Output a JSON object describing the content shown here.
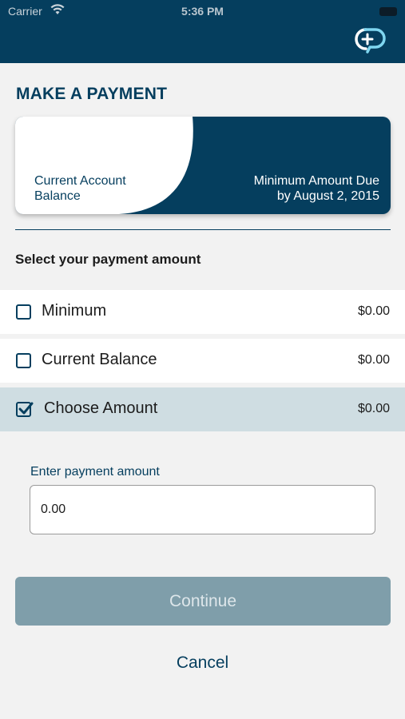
{
  "status_bar": {
    "carrier": "Carrier",
    "time": "5:36 PM"
  },
  "header": {
    "logo_icon": "cp-logo-icon"
  },
  "page": {
    "title": "MAKE A PAYMENT"
  },
  "summary_card": {
    "left_label": "Current Account Balance",
    "right_label_line1": "Minimum Amount Due",
    "right_label_line2": "by August 2, 2015"
  },
  "payment_section": {
    "label": "Select your payment amount",
    "options": [
      {
        "label": "Minimum",
        "value": "$0.00",
        "checked": false
      },
      {
        "label": "Current Balance",
        "value": "$0.00",
        "checked": false
      },
      {
        "label": "Choose Amount",
        "value": "$0.00",
        "checked": true
      }
    ]
  },
  "amount_field": {
    "label": "Enter payment amount",
    "value": "0.00"
  },
  "actions": {
    "continue_label": "Continue",
    "cancel_label": "Cancel"
  },
  "colors": {
    "brand_navy": "#053e5e",
    "selected_row": "#cfdde2",
    "continue_disabled": "#7f9eaa"
  }
}
